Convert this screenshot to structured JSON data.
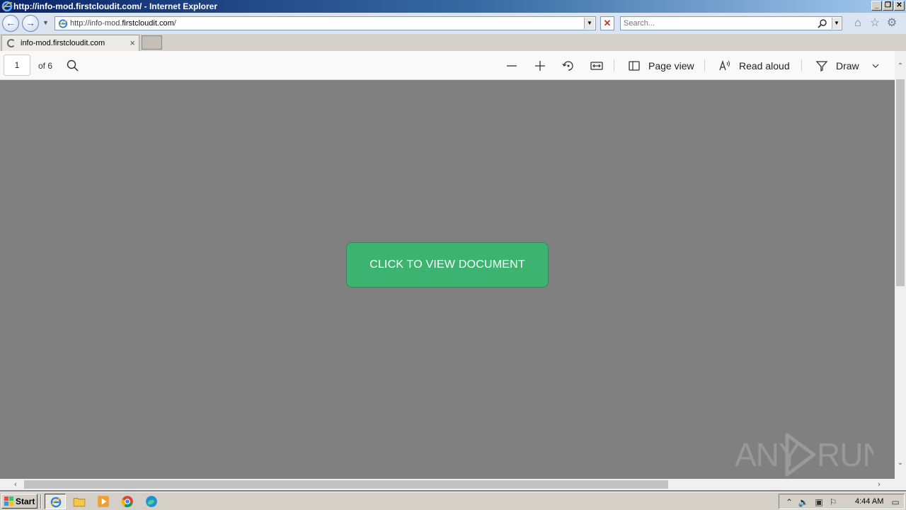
{
  "window": {
    "title": "http://info-mod.firstcloudit.com/ - Internet Explorer",
    "minimize_label": "0",
    "restore_label": "2",
    "close_label": "r"
  },
  "address_bar": {
    "url_prefix": "http://info-mod.",
    "url_domain": "firstcloudit.com",
    "url_suffix": "/"
  },
  "search": {
    "placeholder": "Search..."
  },
  "tabs": [
    {
      "label": "info-mod.firstcloudit.com",
      "loading": true
    }
  ],
  "pdf_toolbar": {
    "page_number": "1",
    "page_count": "of 6",
    "page_view_label": "Page view",
    "read_aloud_label": "Read aloud",
    "draw_label": "Draw"
  },
  "content": {
    "view_button_label": "CLICK TO VIEW DOCUMENT",
    "watermark": "ANY RUN"
  },
  "taskbar": {
    "start_label": "Start",
    "clock": "4:44 AM",
    "apps": [
      "internet-explorer",
      "file-explorer",
      "media-player",
      "chrome",
      "edge"
    ]
  },
  "colors": {
    "button_green": "#3cb371",
    "content_gray": "#808080"
  }
}
